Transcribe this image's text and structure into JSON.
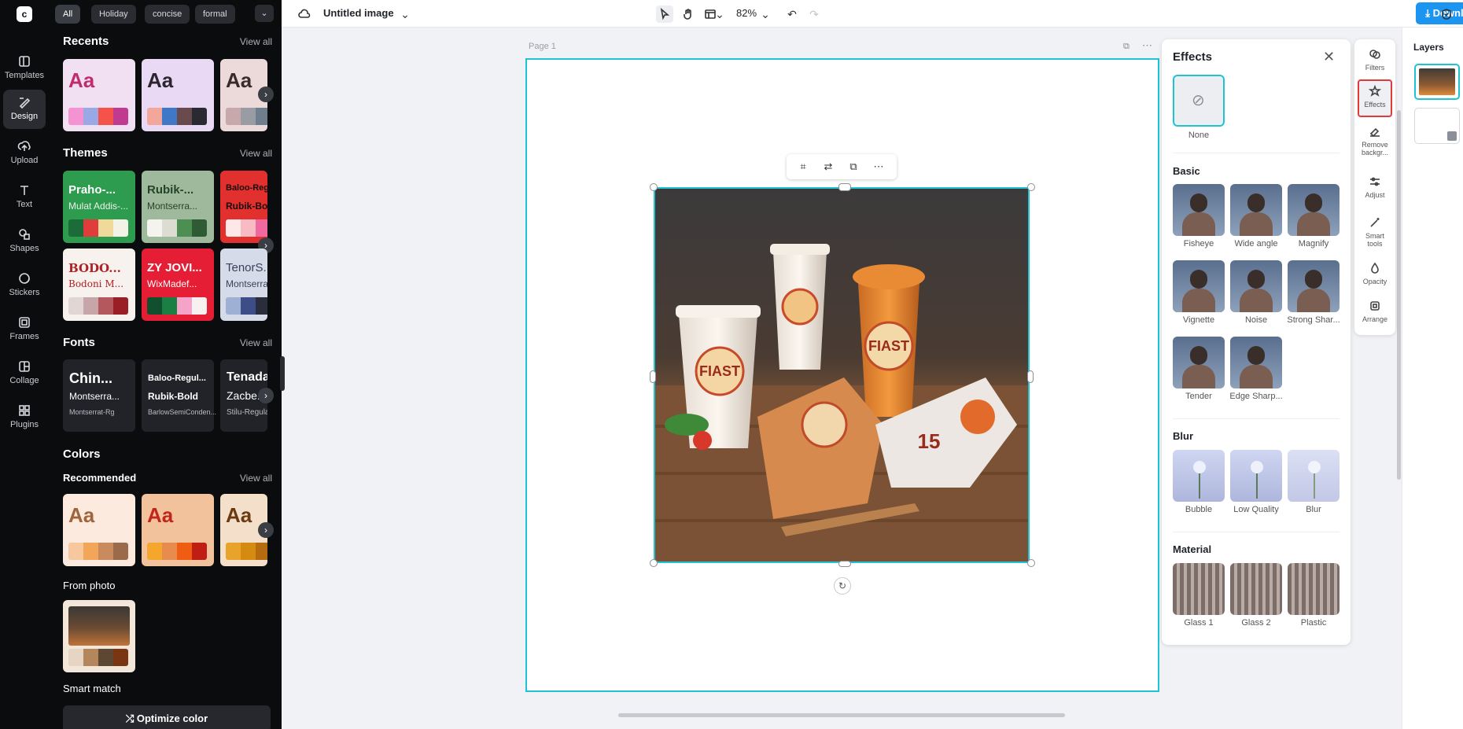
{
  "panel": {
    "chips": [
      "All",
      "Holiday",
      "concise",
      "formal"
    ],
    "recents": {
      "title": "Recents",
      "view_all": "View all",
      "aa": "Aa"
    },
    "themes": {
      "title": "Themes",
      "view_all": "View all",
      "items": [
        {
          "t1": "Praho-...",
          "t2": "Mulat Addis-..."
        },
        {
          "t1": "Rubik-...",
          "t2": "Montserra..."
        },
        {
          "t1": "Baloo-Regu...",
          "t2": "Rubik-Bo..."
        },
        {
          "t1": "BODO...",
          "t2": "Bodoni M..."
        },
        {
          "t1": "ZY JOVI...",
          "t2": "WixMadef..."
        },
        {
          "t1": "TenorS...",
          "t2": "Montserra..."
        }
      ]
    },
    "fonts": {
      "title": "Fonts",
      "view_all": "View all",
      "items": [
        {
          "f1": "Chin...",
          "f2": "Montserra...",
          "f3": "Montserrat-Rg"
        },
        {
          "f1": "Baloo-Regul...",
          "f2": "Rubik-Bold",
          "f3": "BarlowSemiConden..."
        },
        {
          "f1": "Tenada",
          "f2": "Zacbe...",
          "f3": "Stilu-Regula..."
        }
      ]
    },
    "colors": {
      "title": "Colors",
      "recommended": "Recommended",
      "view_all": "View all",
      "aa": "Aa"
    },
    "from_photo": "From photo",
    "smart_match": "Smart match",
    "optimize": "Optimize color"
  },
  "rail": [
    {
      "label": "Templates",
      "icon": "templates-icon"
    },
    {
      "label": "Design",
      "icon": "design-icon"
    },
    {
      "label": "Upload",
      "icon": "upload-icon"
    },
    {
      "label": "Text",
      "icon": "text-icon"
    },
    {
      "label": "Shapes",
      "icon": "shapes-icon"
    },
    {
      "label": "Stickers",
      "icon": "stickers-icon"
    },
    {
      "label": "Frames",
      "icon": "frames-icon"
    },
    {
      "label": "Collage",
      "icon": "collage-icon"
    },
    {
      "label": "Plugins",
      "icon": "plugins-icon"
    }
  ],
  "topbar": {
    "title": "Untitled image",
    "zoom": "82%",
    "download": "Download all"
  },
  "canvas": {
    "page_label": "Page 1"
  },
  "effects": {
    "title": "Effects",
    "none": "None",
    "basic": {
      "title": "Basic",
      "items": [
        "Fisheye",
        "Wide angle",
        "Magnify",
        "Vignette",
        "Noise",
        "Strong Shar...",
        "Tender",
        "Edge Sharp..."
      ]
    },
    "blur": {
      "title": "Blur",
      "items": [
        "Bubble",
        "Low Quality",
        "Blur"
      ]
    },
    "material": {
      "title": "Material",
      "items": [
        "Glass 1",
        "Glass 2",
        "Plastic"
      ]
    }
  },
  "tools": [
    "Filters",
    "Effects",
    "Remove backgr...",
    "Adjust",
    "Smart tools",
    "Opacity",
    "Arrange"
  ],
  "layers": {
    "title": "Layers"
  }
}
